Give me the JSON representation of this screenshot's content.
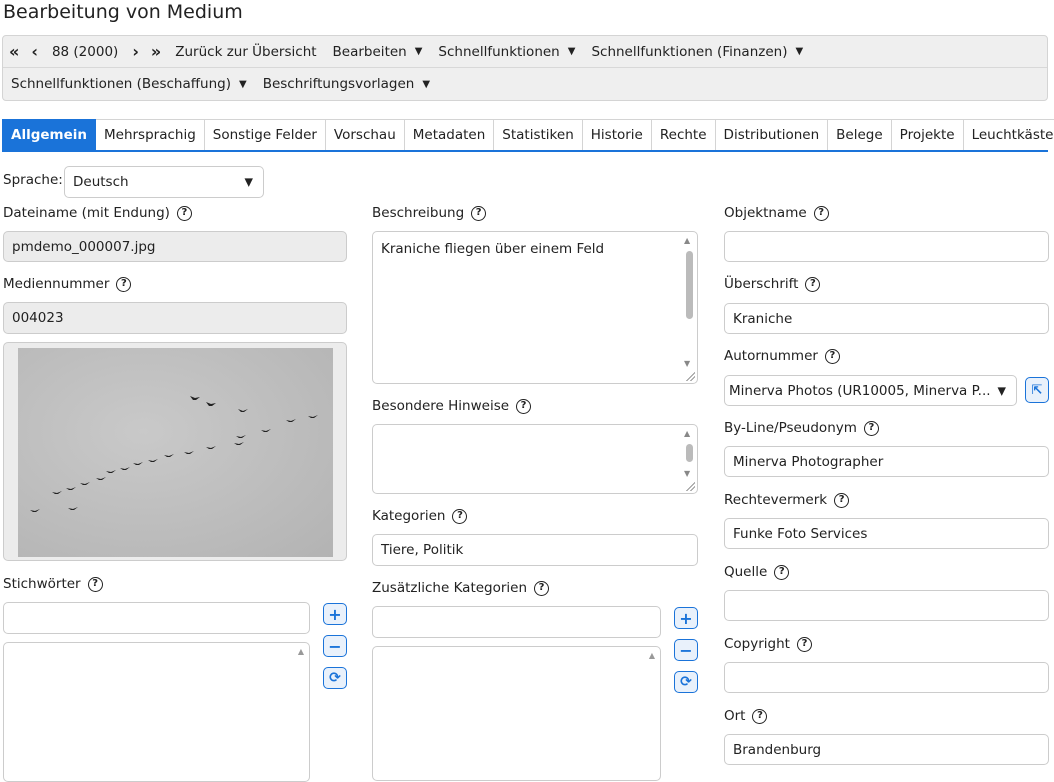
{
  "page": {
    "title": "Bearbeitung von Medium"
  },
  "toolbar": {
    "first": "«",
    "prev": "‹",
    "record": "88 (2000)",
    "next": "›",
    "last": "»",
    "overview": "Zurück zur Übersicht",
    "menus_row1": [
      "Bearbeiten",
      "Schnellfunktionen",
      "Schnellfunktionen (Finanzen)"
    ],
    "menus_row2": [
      "Schnellfunktionen (Beschaffung)",
      "Beschriftungsvorlagen"
    ]
  },
  "tabs": [
    "Allgemein",
    "Mehrsprachig",
    "Sonstige Felder",
    "Vorschau",
    "Metadaten",
    "Statistiken",
    "Historie",
    "Rechte",
    "Distributionen",
    "Belege",
    "Projekte",
    "Leuchtkästen"
  ],
  "form": {
    "sprache_label": "Sprache:",
    "sprache_value": "Deutsch",
    "dateiname_label": "Dateiname (mit Endung)",
    "dateiname_value": "pmdemo_000007.jpg",
    "mediennummer_label": "Mediennummer",
    "mediennummer_value": "004023",
    "stichwoerter_label": "Stichwörter",
    "beschreibung_label": "Beschreibung",
    "beschreibung_value": "Kraniche fliegen über einem Feld",
    "hinweise_label": "Besondere Hinweise",
    "kategorien_label": "Kategorien",
    "kategorien_value": "Tiere, Politik",
    "zus_kategorien_label": "Zusätzliche Kategorien",
    "objektname_label": "Objektname",
    "ueberschrift_label": "Überschrift",
    "ueberschrift_value": "Kraniche",
    "autornummer_label": "Autornummer",
    "autornummer_value": "Minerva Photos (UR10005, Minerva P...",
    "byline_label": "By-Line/Pseudonym",
    "byline_value": "Minerva Photographer",
    "rechtevermerk_label": "Rechtevermerk",
    "rechtevermerk_value": "Funke Foto Services",
    "quelle_label": "Quelle",
    "quelle_value": "",
    "copyright_label": "Copyright",
    "ort_label": "Ort",
    "ort_value": "Brandenburg"
  },
  "icons": {
    "help": "?",
    "chevron": "⌄",
    "plus": "+",
    "minus": "−",
    "refresh": "⟳",
    "external": "⇱"
  },
  "colors": {
    "accent": "#1a73d9"
  }
}
